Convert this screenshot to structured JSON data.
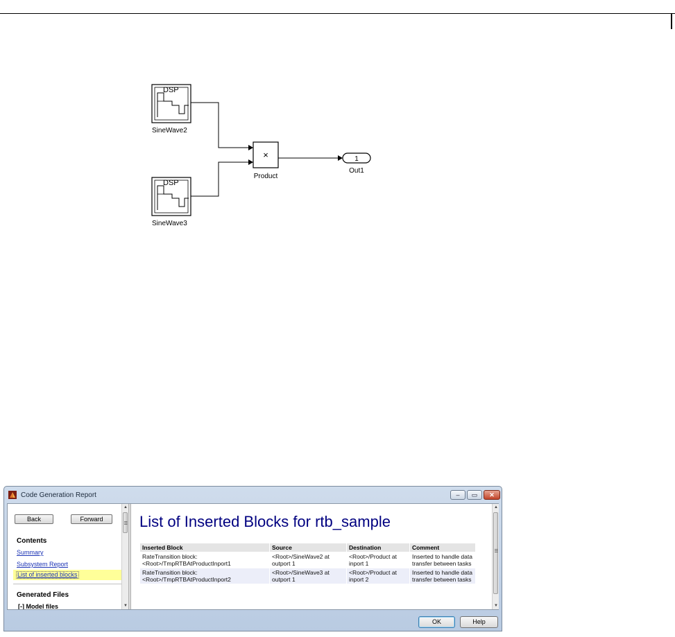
{
  "diagram": {
    "blocks": [
      {
        "id": "sinewave2",
        "label": "SineWave2",
        "badge": "DSP"
      },
      {
        "id": "sinewave3",
        "label": "SineWave3",
        "badge": "DSP"
      },
      {
        "id": "product",
        "label": "Product",
        "symbol": "×"
      },
      {
        "id": "out1",
        "label": "Out1",
        "port_number": "1"
      }
    ]
  },
  "window": {
    "title": "Code Generation Report",
    "controls": {
      "minimize": "–",
      "maximize": "▭",
      "close": "✕"
    }
  },
  "nav": {
    "back_label": "Back",
    "forward_label": "Forward",
    "contents_heading": "Contents",
    "links": [
      "Summary",
      "Subsystem Report"
    ],
    "selected_link": "List of inserted blocks",
    "generated_heading": "Generated Files",
    "tree_item": "[-] Model files"
  },
  "content": {
    "title": "List of Inserted Blocks for rtb_sample",
    "table": {
      "headers": [
        "Inserted Block",
        "Source",
        "Destination",
        "Comment"
      ],
      "rows": [
        {
          "inserted_block": "RateTransition block: <Root>/TmpRTBAtProductInport1",
          "source": "<Root>/SineWave2 at outport 1",
          "destination": "<Root>/Product at inport 1",
          "comment": "Inserted to handle data transfer between tasks"
        },
        {
          "inserted_block": "RateTransition block: <Root>/TmpRTBAtProductInport2",
          "source": "<Root>/SineWave3 at outport 1",
          "destination": "<Root>/Product at inport 2",
          "comment": "Inserted to handle data transfer between tasks"
        }
      ]
    }
  },
  "buttons": {
    "ok": "OK",
    "help": "Help"
  },
  "colors": {
    "title_blue": "#000080",
    "link_blue": "#1a32b4",
    "selection_yellow": "#ffff99",
    "close_red": "#c2442a"
  }
}
